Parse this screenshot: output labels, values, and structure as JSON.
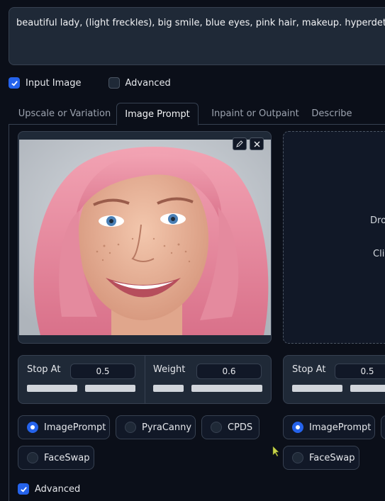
{
  "prompt": {
    "text": "beautiful lady, (light freckles), big smile, blue eyes, pink hair, makeup. hyperdetailed photo"
  },
  "options": {
    "input_image": {
      "label": "Input Image",
      "checked": true
    },
    "advanced": {
      "label": "Advanced",
      "checked": false
    }
  },
  "tabs": [
    {
      "label": "Upscale or Variation",
      "active": false
    },
    {
      "label": "Image Prompt",
      "active": true
    },
    {
      "label": "Inpaint or Outpaint",
      "active": false
    },
    {
      "label": "Describe",
      "active": false
    }
  ],
  "image_slot_1": {
    "edit_icon": "pencil-icon",
    "close_icon": "close-icon",
    "stop_at": {
      "label": "Stop At",
      "value": "0.5",
      "fraction": 0.5
    },
    "weight": {
      "label": "Weight",
      "value": "0.6",
      "fraction": 0.3
    },
    "types": [
      {
        "label": "ImagePrompt",
        "selected": true
      },
      {
        "label": "PyraCanny",
        "selected": false
      },
      {
        "label": "CPDS",
        "selected": false
      },
      {
        "label": "FaceSwap",
        "selected": false
      }
    ]
  },
  "image_slot_2": {
    "drop_line1": "Dro",
    "drop_line2": "Cli",
    "stop_at": {
      "label": "Stop At",
      "value": "0.5"
    },
    "types": [
      {
        "label": "ImagePrompt",
        "selected": true
      },
      {
        "label": "FaceSwap",
        "selected": false
      }
    ]
  },
  "advanced_bottom": {
    "label": "Advanced",
    "checked": true
  },
  "colors": {
    "accent": "#2563eb",
    "background": "#0b0f19",
    "card": "#1f2937"
  }
}
